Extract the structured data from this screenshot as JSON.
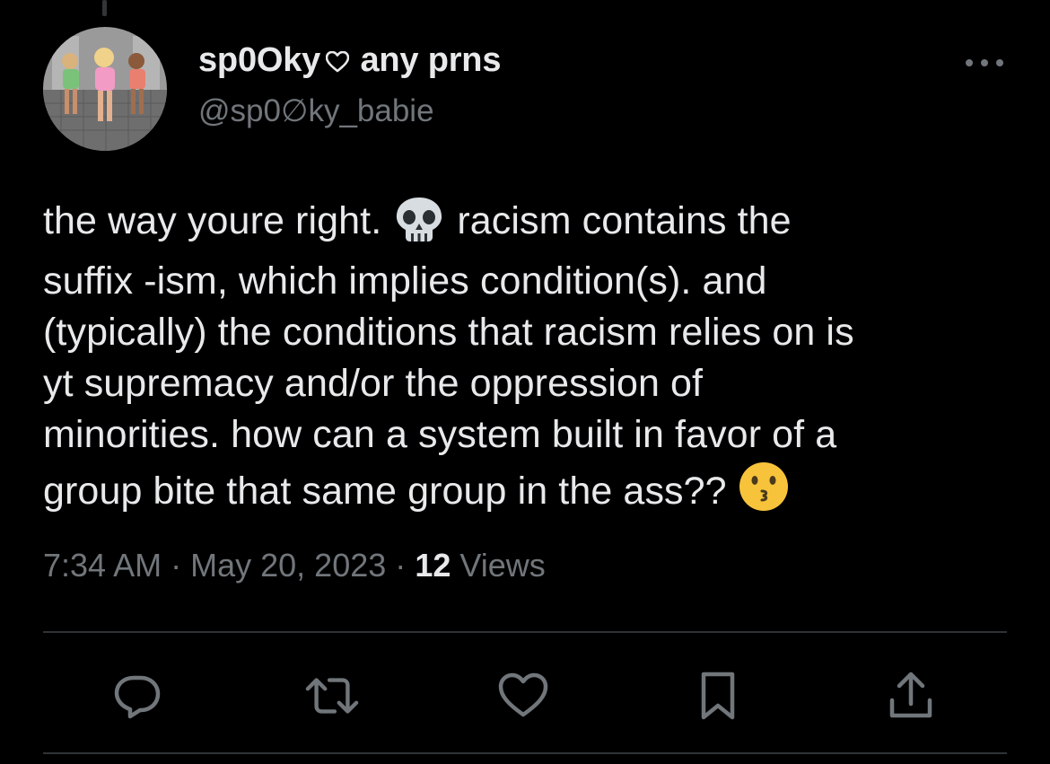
{
  "author": {
    "display_name": "sp0Oky",
    "pronouns": "any prns",
    "handle": "@sp0∅ky_babie"
  },
  "tweet": {
    "lines": [
      "the way youre right.",
      "racism contains the",
      "suffix -ism, which implies condition(s). and",
      "(typically) the conditions that racism relies on is",
      "yt supremacy and/or the oppression of",
      "minorities. how can a system built in favor of a",
      "group bite that same group in the ass??"
    ],
    "emojis": [
      "skull-emoji",
      "kissing-face-emoji"
    ]
  },
  "meta": {
    "time": "7:34 AM",
    "separator": "·",
    "date": "May 20, 2023",
    "views_count": "12",
    "views_label": "Views"
  },
  "actions": [
    "reply",
    "retweet",
    "like",
    "bookmark",
    "share"
  ],
  "colors": {
    "background": "#000000",
    "text": "#e7e9ea",
    "secondary": "#71767b",
    "divider": "#2f3336"
  }
}
